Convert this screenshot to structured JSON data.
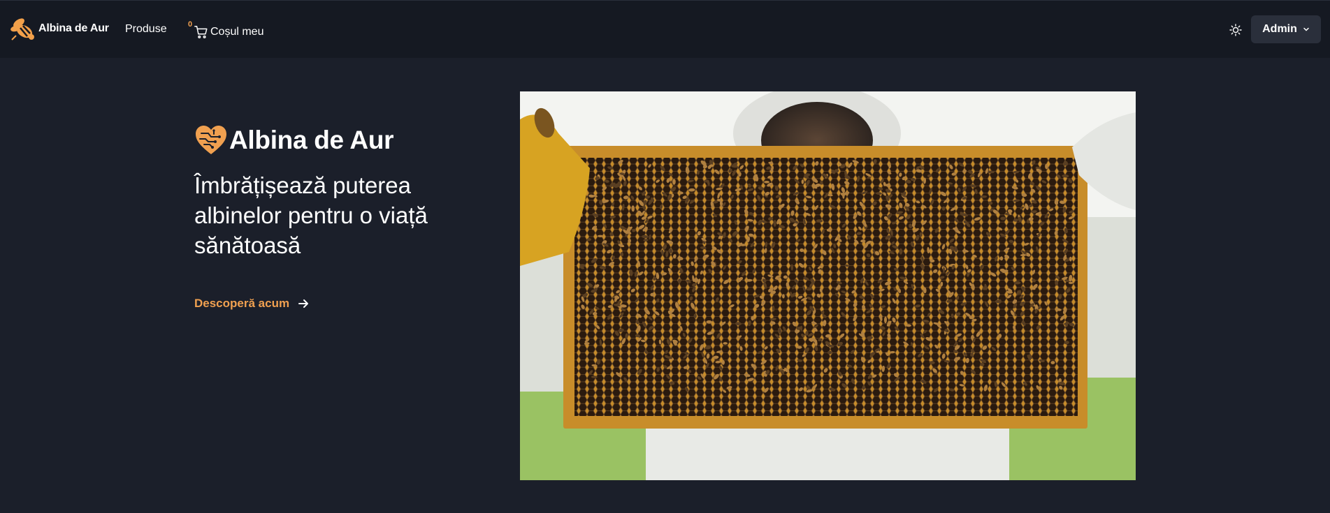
{
  "navbar": {
    "brand_name": "Albina de Aur",
    "links": [
      {
        "label": "Produse"
      }
    ],
    "cart": {
      "label": "Coșul meu",
      "badge": "0",
      "icon": "cart-icon"
    },
    "theme_icon": "sun-icon",
    "user_menu": {
      "label": "Admin",
      "icon": "chevron-down-icon"
    }
  },
  "hero": {
    "title": "Albina de Aur",
    "tagline": "Îmbrățișează puterea albinelor pentru o viață sănătoasă",
    "cta_label": "Descoperă acum",
    "cta_icon": "arrow-right-icon",
    "image_subject": "beekeeper-holding-honeycomb-frame"
  },
  "colors": {
    "background": "#1b1f2a",
    "navbar": "#151922",
    "accent": "#f0a050",
    "button": "#2a2f3b"
  }
}
